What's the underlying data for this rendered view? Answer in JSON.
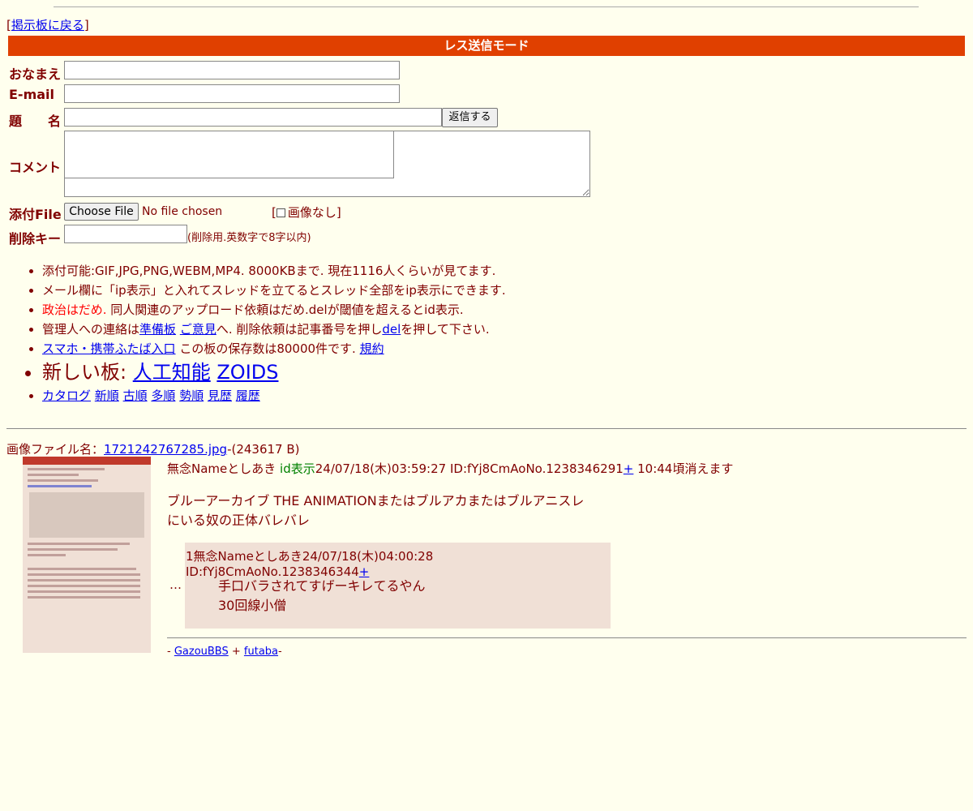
{
  "nav": {
    "back_link": "掲示板に戻る",
    "bracket_open": "[",
    "bracket_close": "]"
  },
  "form": {
    "mode_title": "レス送信モード",
    "labels": {
      "name": "おなまえ",
      "email": "E-mail",
      "subject": "題　　名",
      "comment": "コメント",
      "file": "添付File",
      "delkey": "削除キー"
    },
    "submit_label": "返信する",
    "file_button": "Choose File",
    "file_status": "No file chosen",
    "no_image": "[画像なし]",
    "no_image_open": "[",
    "no_image_label": "画像なし",
    "no_image_close": "]",
    "delkey_hint": "(削除用.英数字で8字以内)"
  },
  "rules": {
    "r1": "添付可能:GIF,JPG,PNG,WEBM,MP4. 8000KBまで. 現在1116人くらいが見てます.",
    "r2": "メール欄に「ip表示」と入れてスレッドを立てるとスレッド全部をip表示にできます.",
    "r3_red": "政治はだめ.",
    "r3_rest": " 同人関連のアップロード依頼はだめ.delが閾値を超えるとid表示.",
    "r4_pre": "管理人への連絡は",
    "r4_link1": "準備板",
    "r4_link2": "ご意見",
    "r4_mid": "へ. 削除依頼は記事番号を押し",
    "r4_link3": "del",
    "r4_post": "を押して下さい.",
    "r5_link1": "スマホ・携帯ふたば入口",
    "r5_mid": " この板の保存数は80000件です. ",
    "r5_link2": "規約",
    "r6_pre": "新しい板: ",
    "r6_link1": "人工知能",
    "r6_link2": "ZOIDS",
    "r7_links": [
      "カタログ",
      "新順",
      "古順",
      "多順",
      "勢順",
      "見歴",
      "履歴"
    ]
  },
  "thread": {
    "file_label": "画像ファイル名：",
    "file_name": "1721242767285.jpg",
    "file_size": "-(243617 B)",
    "op": {
      "name": "無念Nameとしあき",
      "id_display": "id表示",
      "date": "24/07/18(木)03:59:27",
      "id": "ID:fYj8CmAo",
      "no": "No.1238346291",
      "plus": "+",
      "expire": " 10:44頃消えます",
      "text_line1": "ブルーアーカイブ THE ANIMATIONまたはブルアカまたはブルアニスレ",
      "text_line2": "にいる奴の正体バレバレ"
    },
    "reply": {
      "ellipsis": "…",
      "number": "1",
      "name": "無念Nameとしあき",
      "date": "24/07/18(木)04:00:28",
      "id": "ID:fYj8CmAo",
      "no": "No.1238346344",
      "plus": "+",
      "line1": "手口バラされてすげーキレてるやん",
      "line2": "30回線小僧"
    }
  },
  "footer": {
    "link1": "GazouBBS",
    "sep": " + ",
    "link2": "futaba",
    "pre": "- ",
    "post": "-"
  },
  "colors": {
    "background": "#ffffee",
    "text": "#800000",
    "mode_bar": "#e04000",
    "reply_bg": "#f0e0d6",
    "id_green": "#008000"
  }
}
